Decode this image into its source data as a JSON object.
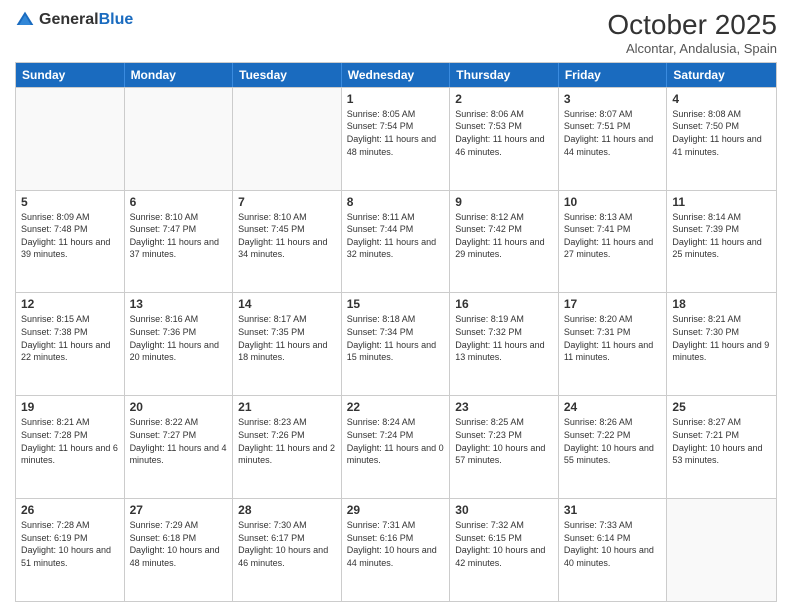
{
  "logo": {
    "general": "General",
    "blue": "Blue"
  },
  "header": {
    "month": "October 2025",
    "location": "Alcontar, Andalusia, Spain"
  },
  "weekdays": [
    "Sunday",
    "Monday",
    "Tuesday",
    "Wednesday",
    "Thursday",
    "Friday",
    "Saturday"
  ],
  "rows": [
    [
      {
        "day": "",
        "info": ""
      },
      {
        "day": "",
        "info": ""
      },
      {
        "day": "",
        "info": ""
      },
      {
        "day": "1",
        "info": "Sunrise: 8:05 AM\nSunset: 7:54 PM\nDaylight: 11 hours and 48 minutes."
      },
      {
        "day": "2",
        "info": "Sunrise: 8:06 AM\nSunset: 7:53 PM\nDaylight: 11 hours and 46 minutes."
      },
      {
        "day": "3",
        "info": "Sunrise: 8:07 AM\nSunset: 7:51 PM\nDaylight: 11 hours and 44 minutes."
      },
      {
        "day": "4",
        "info": "Sunrise: 8:08 AM\nSunset: 7:50 PM\nDaylight: 11 hours and 41 minutes."
      }
    ],
    [
      {
        "day": "5",
        "info": "Sunrise: 8:09 AM\nSunset: 7:48 PM\nDaylight: 11 hours and 39 minutes."
      },
      {
        "day": "6",
        "info": "Sunrise: 8:10 AM\nSunset: 7:47 PM\nDaylight: 11 hours and 37 minutes."
      },
      {
        "day": "7",
        "info": "Sunrise: 8:10 AM\nSunset: 7:45 PM\nDaylight: 11 hours and 34 minutes."
      },
      {
        "day": "8",
        "info": "Sunrise: 8:11 AM\nSunset: 7:44 PM\nDaylight: 11 hours and 32 minutes."
      },
      {
        "day": "9",
        "info": "Sunrise: 8:12 AM\nSunset: 7:42 PM\nDaylight: 11 hours and 29 minutes."
      },
      {
        "day": "10",
        "info": "Sunrise: 8:13 AM\nSunset: 7:41 PM\nDaylight: 11 hours and 27 minutes."
      },
      {
        "day": "11",
        "info": "Sunrise: 8:14 AM\nSunset: 7:39 PM\nDaylight: 11 hours and 25 minutes."
      }
    ],
    [
      {
        "day": "12",
        "info": "Sunrise: 8:15 AM\nSunset: 7:38 PM\nDaylight: 11 hours and 22 minutes."
      },
      {
        "day": "13",
        "info": "Sunrise: 8:16 AM\nSunset: 7:36 PM\nDaylight: 11 hours and 20 minutes."
      },
      {
        "day": "14",
        "info": "Sunrise: 8:17 AM\nSunset: 7:35 PM\nDaylight: 11 hours and 18 minutes."
      },
      {
        "day": "15",
        "info": "Sunrise: 8:18 AM\nSunset: 7:34 PM\nDaylight: 11 hours and 15 minutes."
      },
      {
        "day": "16",
        "info": "Sunrise: 8:19 AM\nSunset: 7:32 PM\nDaylight: 11 hours and 13 minutes."
      },
      {
        "day": "17",
        "info": "Sunrise: 8:20 AM\nSunset: 7:31 PM\nDaylight: 11 hours and 11 minutes."
      },
      {
        "day": "18",
        "info": "Sunrise: 8:21 AM\nSunset: 7:30 PM\nDaylight: 11 hours and 9 minutes."
      }
    ],
    [
      {
        "day": "19",
        "info": "Sunrise: 8:21 AM\nSunset: 7:28 PM\nDaylight: 11 hours and 6 minutes."
      },
      {
        "day": "20",
        "info": "Sunrise: 8:22 AM\nSunset: 7:27 PM\nDaylight: 11 hours and 4 minutes."
      },
      {
        "day": "21",
        "info": "Sunrise: 8:23 AM\nSunset: 7:26 PM\nDaylight: 11 hours and 2 minutes."
      },
      {
        "day": "22",
        "info": "Sunrise: 8:24 AM\nSunset: 7:24 PM\nDaylight: 11 hours and 0 minutes."
      },
      {
        "day": "23",
        "info": "Sunrise: 8:25 AM\nSunset: 7:23 PM\nDaylight: 10 hours and 57 minutes."
      },
      {
        "day": "24",
        "info": "Sunrise: 8:26 AM\nSunset: 7:22 PM\nDaylight: 10 hours and 55 minutes."
      },
      {
        "day": "25",
        "info": "Sunrise: 8:27 AM\nSunset: 7:21 PM\nDaylight: 10 hours and 53 minutes."
      }
    ],
    [
      {
        "day": "26",
        "info": "Sunrise: 7:28 AM\nSunset: 6:19 PM\nDaylight: 10 hours and 51 minutes."
      },
      {
        "day": "27",
        "info": "Sunrise: 7:29 AM\nSunset: 6:18 PM\nDaylight: 10 hours and 48 minutes."
      },
      {
        "day": "28",
        "info": "Sunrise: 7:30 AM\nSunset: 6:17 PM\nDaylight: 10 hours and 46 minutes."
      },
      {
        "day": "29",
        "info": "Sunrise: 7:31 AM\nSunset: 6:16 PM\nDaylight: 10 hours and 44 minutes."
      },
      {
        "day": "30",
        "info": "Sunrise: 7:32 AM\nSunset: 6:15 PM\nDaylight: 10 hours and 42 minutes."
      },
      {
        "day": "31",
        "info": "Sunrise: 7:33 AM\nSunset: 6:14 PM\nDaylight: 10 hours and 40 minutes."
      },
      {
        "day": "",
        "info": ""
      }
    ]
  ]
}
